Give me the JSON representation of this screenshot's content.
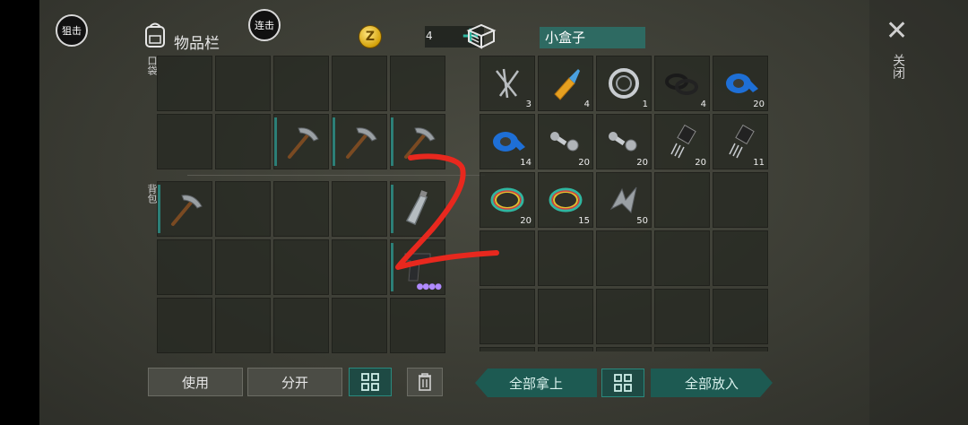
{
  "hud": {
    "snipe_label": "狙击",
    "combo_label": "连击"
  },
  "inventory": {
    "title": "物品栏",
    "pocket_label": "口袋",
    "backpack_label": "背包"
  },
  "currency": {
    "count": "4",
    "plus_label": "+"
  },
  "container": {
    "name": "小盒子"
  },
  "actions": {
    "use_label": "使用",
    "split_label": "分开",
    "take_all_label": "全部拿上",
    "put_all_label": "全部放入"
  },
  "close": {
    "icon": "close-icon",
    "label": "关闭"
  },
  "pocket_slots": [
    "",
    "",
    "",
    "",
    "",
    "",
    "",
    "pickaxe",
    "pickaxe",
    "pickaxe"
  ],
  "backpack_slots": [
    "pickaxe",
    "",
    "",
    "",
    "bottle",
    "",
    "",
    "",
    "",
    "pistol",
    "",
    "",
    "",
    "",
    ""
  ],
  "container_slots": [
    {
      "item": "nails",
      "count": "3"
    },
    {
      "item": "glue",
      "count": "4"
    },
    {
      "item": "bearing",
      "count": "1"
    },
    {
      "item": "rubber-rings",
      "count": "4"
    },
    {
      "item": "blue-tape",
      "count": "20"
    },
    {
      "item": "blue-tape",
      "count": "14"
    },
    {
      "item": "bolts",
      "count": "20"
    },
    {
      "item": "bolts",
      "count": "20"
    },
    {
      "item": "transistor",
      "count": "20"
    },
    {
      "item": "transistor",
      "count": "11"
    },
    {
      "item": "wires",
      "count": "20"
    },
    {
      "item": "wires",
      "count": "15"
    },
    {
      "item": "scrap-metal",
      "count": "50"
    },
    {
      "item": "",
      "count": ""
    },
    {
      "item": "",
      "count": ""
    },
    {
      "item": "",
      "count": ""
    },
    {
      "item": "",
      "count": ""
    },
    {
      "item": "",
      "count": ""
    },
    {
      "item": "",
      "count": ""
    },
    {
      "item": "",
      "count": ""
    },
    {
      "item": "",
      "count": ""
    },
    {
      "item": "",
      "count": ""
    },
    {
      "item": "",
      "count": ""
    },
    {
      "item": "",
      "count": ""
    },
    {
      "item": "",
      "count": ""
    },
    {
      "item": "",
      "count": ""
    },
    {
      "item": "",
      "count": ""
    },
    {
      "item": "",
      "count": ""
    },
    {
      "item": "",
      "count": ""
    },
    {
      "item": "",
      "count": ""
    }
  ],
  "annotation": {
    "text": "2",
    "color": "#e8281e"
  }
}
